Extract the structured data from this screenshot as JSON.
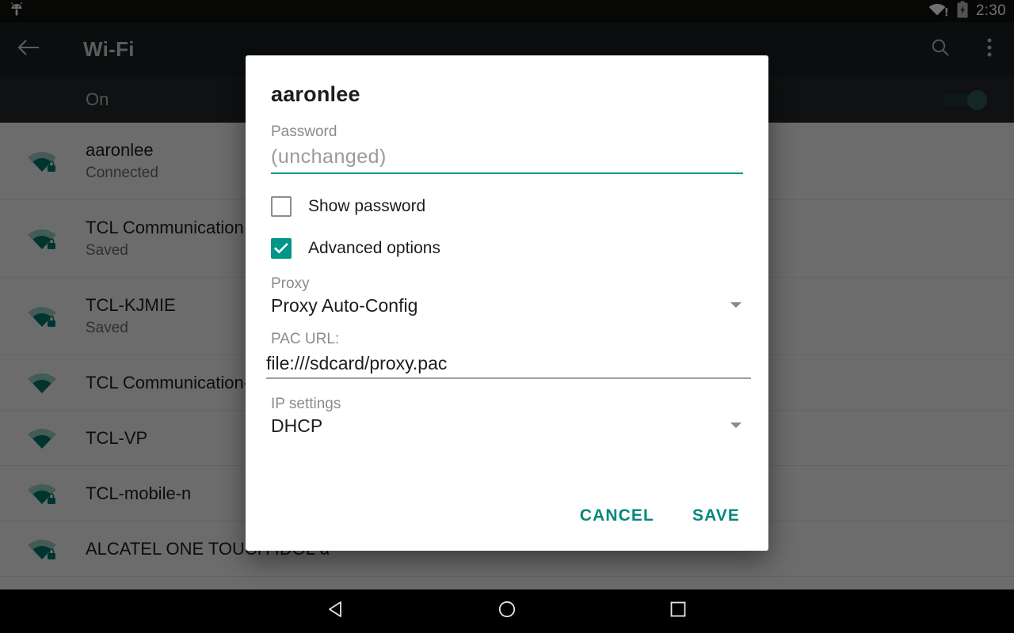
{
  "status_bar": {
    "time": "2:30",
    "icons": [
      "android-head-icon",
      "wifi-warning-icon",
      "battery-charging-icon"
    ]
  },
  "toolbar": {
    "back_icon": "back-arrow-icon",
    "title": "Wi-Fi",
    "search_icon": "search-icon",
    "overflow_icon": "overflow-menu-icon"
  },
  "wifi_state": {
    "label": "On",
    "switch_on": true
  },
  "networks": [
    {
      "name": "aaronlee",
      "status": "Connected",
      "secured": true,
      "signal": 4
    },
    {
      "name": "TCL Communication",
      "status": "Saved",
      "secured": true,
      "signal": 4
    },
    {
      "name": "TCL-KJMIE",
      "status": "Saved",
      "secured": true,
      "signal": 4
    },
    {
      "name": "TCL Communication-",
      "status": "",
      "secured": false,
      "signal": 4
    },
    {
      "name": "TCL-VP",
      "status": "",
      "secured": false,
      "signal": 4
    },
    {
      "name": "TCL-mobile-n",
      "status": "",
      "secured": true,
      "signal": 4
    },
    {
      "name": "ALCATEL ONE TOUCH IDOL α",
      "status": "",
      "secured": true,
      "signal": 4
    }
  ],
  "dialog": {
    "title": "aaronlee",
    "password_label": "Password",
    "password_value": "(unchanged)",
    "show_password": {
      "label": "Show password",
      "checked": false
    },
    "advanced_options": {
      "label": "Advanced options",
      "checked": true
    },
    "proxy": {
      "label": "Proxy",
      "value": "Proxy Auto-Config",
      "dropdown_icon": "chevron-down-icon"
    },
    "pac_url": {
      "label": "PAC URL:",
      "value": "file:///sdcard/proxy.pac"
    },
    "ip_settings": {
      "label": "IP settings",
      "value": "DHCP",
      "dropdown_icon": "chevron-down-icon"
    },
    "cancel_label": "CANCEL",
    "save_label": "SAVE"
  },
  "nav_bar": {
    "back_icon": "nav-back-triangle-icon",
    "home_icon": "nav-home-circle-icon",
    "recents_icon": "nav-recents-square-icon"
  },
  "colors": {
    "accent": "#009688",
    "action_text": "#00897b",
    "toolbar_bg": "#1b2024",
    "statusbar_bg": "#10100f"
  }
}
